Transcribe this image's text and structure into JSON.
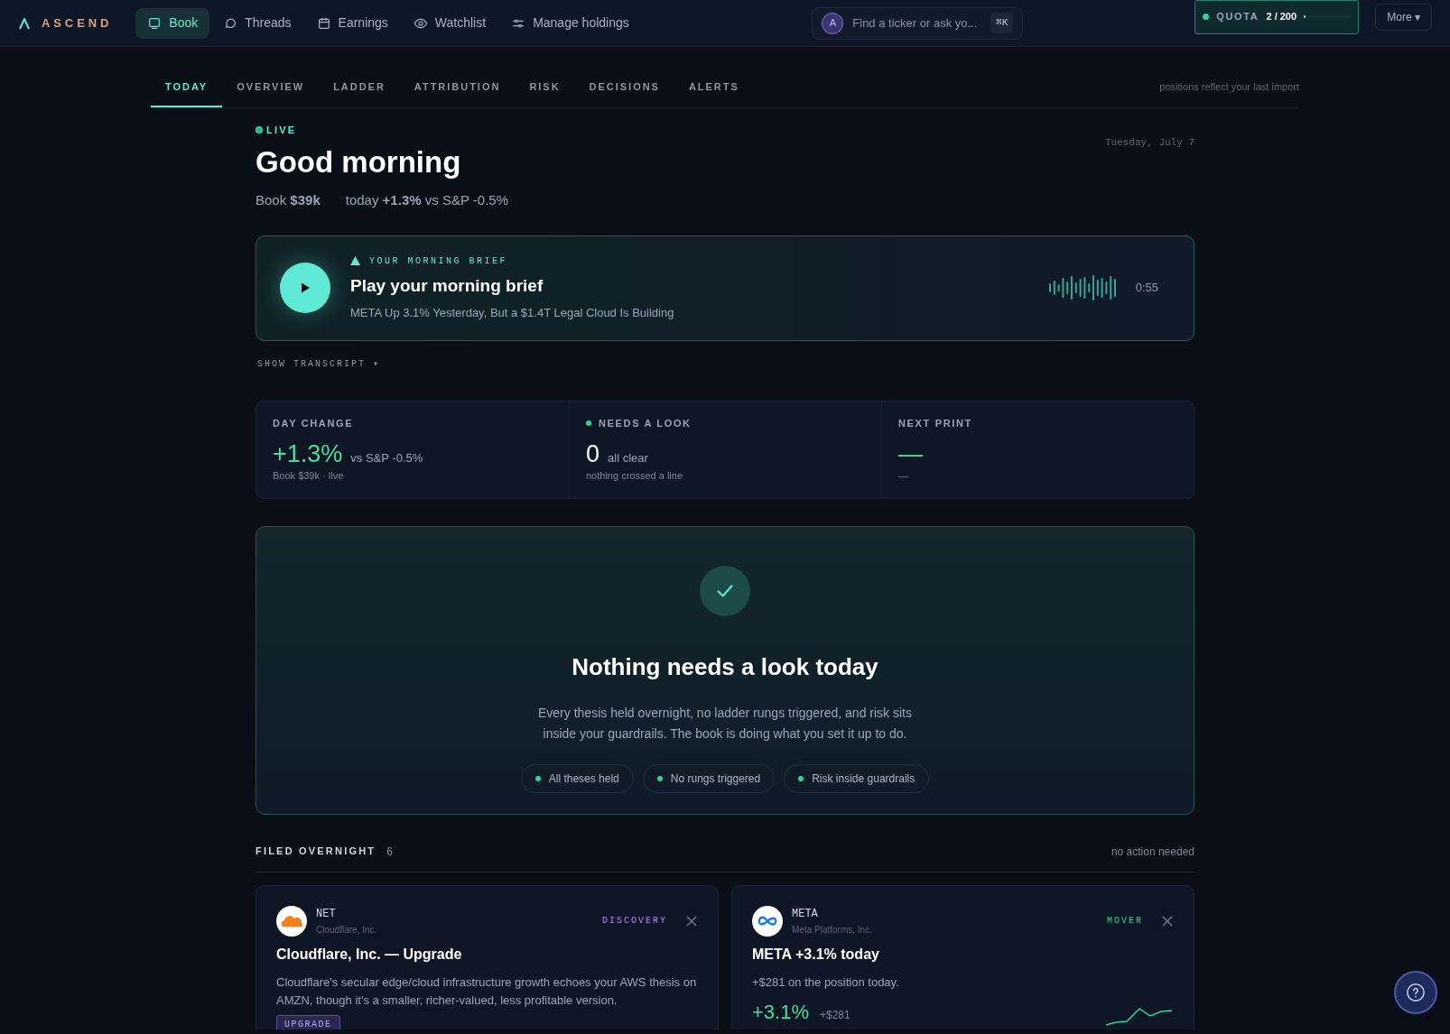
{
  "brand": "ASCEND",
  "nav": [
    {
      "label": "Book",
      "selected": true
    },
    {
      "label": "Threads",
      "selected": false
    },
    {
      "label": "Earnings",
      "selected": false
    },
    {
      "label": "Watchlist",
      "selected": false
    },
    {
      "label": "Manage holdings",
      "selected": false
    }
  ],
  "search": {
    "avatar": "A",
    "placeholder": "Find a ticker or ask yo...",
    "shortcut": "⌘K"
  },
  "quota": {
    "label": "QUOTA",
    "value": "2 / 200",
    "level": 0.01
  },
  "more": "More ▾",
  "tabs": [
    {
      "label": "TODAY",
      "selected": true
    },
    {
      "label": "OVERVIEW",
      "selected": false
    },
    {
      "label": "LADDER",
      "selected": false
    },
    {
      "label": "ATTRIBUTION",
      "selected": false
    },
    {
      "label": "RISK",
      "selected": false
    },
    {
      "label": "DECISIONS",
      "selected": false
    },
    {
      "label": "ALERTS",
      "selected": false
    }
  ],
  "tabs_note": "positions reflect your last import",
  "header": {
    "live": "LIVE",
    "date": "Tuesday, July 7",
    "greeting": "Good morning",
    "summary": "Book **$39k**",
    "today": "today **+1.3%** vs S&P -0.5%"
  },
  "brief": {
    "eyebrow": "YOUR MORNING BRIEF",
    "title": "Play your morning brief",
    "subtitle": "META Up 3.1% Yesterday, But a $1.4T Legal Cloud Is Building",
    "duration": "0:55"
  },
  "transcript_toggle": "SHOW TRANSCRIPT ▾",
  "stats": [
    {
      "label": "DAY CHANGE",
      "dot": false,
      "value": "+1.3%",
      "value_note": "vs S&P -0.5%",
      "sub": "Book $39k · live"
    },
    {
      "label": "NEEDS A LOOK",
      "dot": true,
      "value": "0",
      "value_note": "all clear",
      "sub": "nothing crossed a line"
    },
    {
      "label": "NEXT PRINT",
      "dot": false,
      "value": "—",
      "sub": "—"
    }
  ],
  "all_clear": {
    "title": "Nothing needs a look today",
    "body": "Every thesis held overnight, no ladder rungs triggered, and risk sits inside your guardrails. The book is doing what you set it up to do.",
    "chips": [
      "All theses held",
      "No rungs triggered",
      "Risk inside guardrails"
    ]
  },
  "filed": {
    "title": "FILED OVERNIGHT",
    "count": "6",
    "note": "no action needed",
    "cards": [
      {
        "kind": "discovery",
        "ticker": "NET",
        "company": "Cloudflare, Inc.",
        "tag": "DISCOVERY",
        "color": "#a78bfa",
        "title": "Cloudflare, Inc. — Upgrade",
        "body": "Cloudflare's secular edge/cloud infrastructure growth echoes your AWS thesis on AMZN, though it's a smaller, richer-valued, less profitable version.",
        "badge": "UPGRADE"
      },
      {
        "kind": "mover",
        "ticker": "META",
        "company": "Meta Platforms, Inc.",
        "tag": "MOVER",
        "color": "#34d399",
        "title": "META +3.1% today",
        "body": "+$281 on the position today.",
        "change": "+3.1%",
        "amount": "+$281"
      }
    ]
  }
}
